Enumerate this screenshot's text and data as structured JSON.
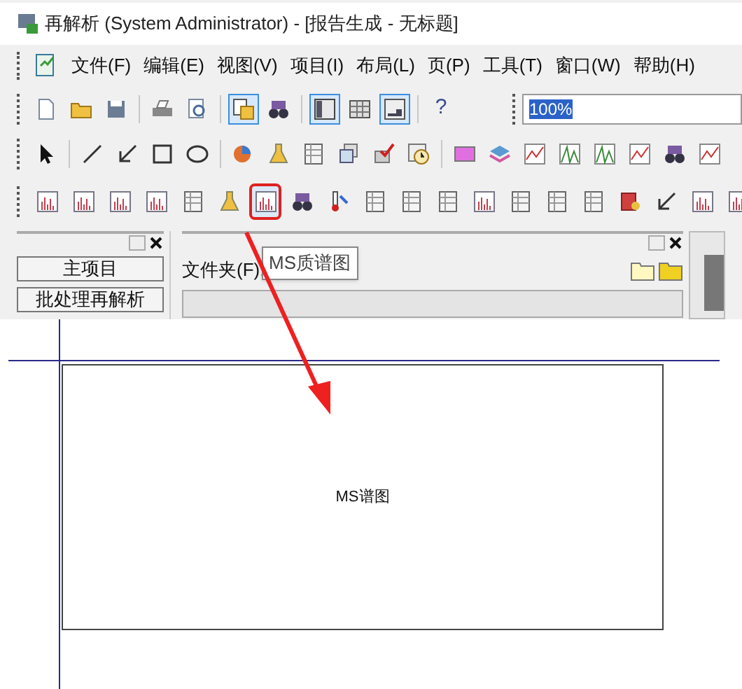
{
  "window": {
    "title": "再解析 (System Administrator) - [报告生成 - 无标题]"
  },
  "menu": [
    {
      "label": "文件(F)"
    },
    {
      "label": "编辑(E)"
    },
    {
      "label": "视图(V)"
    },
    {
      "label": "项目(I)"
    },
    {
      "label": "布局(L)"
    },
    {
      "label": "页(P)"
    },
    {
      "label": "工具(T)"
    },
    {
      "label": "窗口(W)"
    },
    {
      "label": "帮助(H)"
    }
  ],
  "toolbar_1": [
    {
      "kind": "new",
      "pressed": false
    },
    {
      "kind": "open",
      "pressed": false
    },
    {
      "kind": "save",
      "pressed": false
    },
    {
      "kind": "sep"
    },
    {
      "kind": "print",
      "pressed": false
    },
    {
      "kind": "preview",
      "pressed": false
    },
    {
      "kind": "sep"
    },
    {
      "kind": "copy",
      "pressed": true
    },
    {
      "kind": "binoculars",
      "pressed": false
    },
    {
      "kind": "sep"
    },
    {
      "kind": "layout",
      "pressed": true
    },
    {
      "kind": "grid",
      "pressed": false
    },
    {
      "kind": "corner",
      "pressed": true
    },
    {
      "kind": "sep"
    },
    {
      "kind": "text",
      "text": "?",
      "pressed": false
    }
  ],
  "zoom_field": {
    "value": "100%"
  },
  "toolbar_2": [
    {
      "kind": "pointer",
      "pressed": false
    },
    {
      "kind": "sep"
    },
    {
      "kind": "line",
      "pressed": false
    },
    {
      "kind": "arrow",
      "pressed": false
    },
    {
      "kind": "rect",
      "pressed": false
    },
    {
      "kind": "ellipse",
      "pressed": false
    },
    {
      "kind": "sep"
    },
    {
      "kind": "pie",
      "pressed": false
    },
    {
      "kind": "flask",
      "pressed": false
    },
    {
      "kind": "table",
      "pressed": false
    },
    {
      "kind": "stack",
      "pressed": false
    },
    {
      "kind": "check",
      "pressed": false
    },
    {
      "kind": "clock",
      "pressed": false
    },
    {
      "kind": "sep"
    },
    {
      "kind": "gradient",
      "pressed": false
    },
    {
      "kind": "layers",
      "pressed": false
    },
    {
      "kind": "chart",
      "pressed": false
    },
    {
      "kind": "peaks",
      "pressed": false
    },
    {
      "kind": "peaks",
      "pressed": false
    },
    {
      "kind": "chart",
      "pressed": false
    },
    {
      "kind": "binoculars",
      "pressed": false
    },
    {
      "kind": "chart",
      "pressed": false
    }
  ],
  "toolbar_3": [
    {
      "kind": "spectrum",
      "selected": false
    },
    {
      "kind": "spectrum",
      "selected": false
    },
    {
      "kind": "spectrum",
      "selected": false
    },
    {
      "kind": "spectrum",
      "selected": false
    },
    {
      "kind": "table",
      "selected": false
    },
    {
      "kind": "flask",
      "selected": false
    },
    {
      "kind": "spectrum",
      "selected": true
    },
    {
      "kind": "binoculars",
      "selected": false
    },
    {
      "kind": "thermometer",
      "selected": false
    },
    {
      "kind": "table",
      "selected": false
    },
    {
      "kind": "table",
      "selected": false
    },
    {
      "kind": "table",
      "selected": false
    },
    {
      "kind": "spectrum",
      "selected": false
    },
    {
      "kind": "table",
      "selected": false
    },
    {
      "kind": "table",
      "selected": false
    },
    {
      "kind": "table",
      "selected": false
    },
    {
      "kind": "database",
      "selected": false
    },
    {
      "kind": "arrow",
      "selected": false
    },
    {
      "kind": "spectrum",
      "selected": false
    },
    {
      "kind": "spectrum",
      "selected": false
    }
  ],
  "left_panel": {
    "items": [
      {
        "label": "主项目"
      },
      {
        "label": "批处理再解析"
      }
    ]
  },
  "folder_panel": {
    "label": "文件夹(F):"
  },
  "tooltip": {
    "text": "MS质谱图"
  },
  "canvas": {
    "frame_label": "MS谱图"
  }
}
